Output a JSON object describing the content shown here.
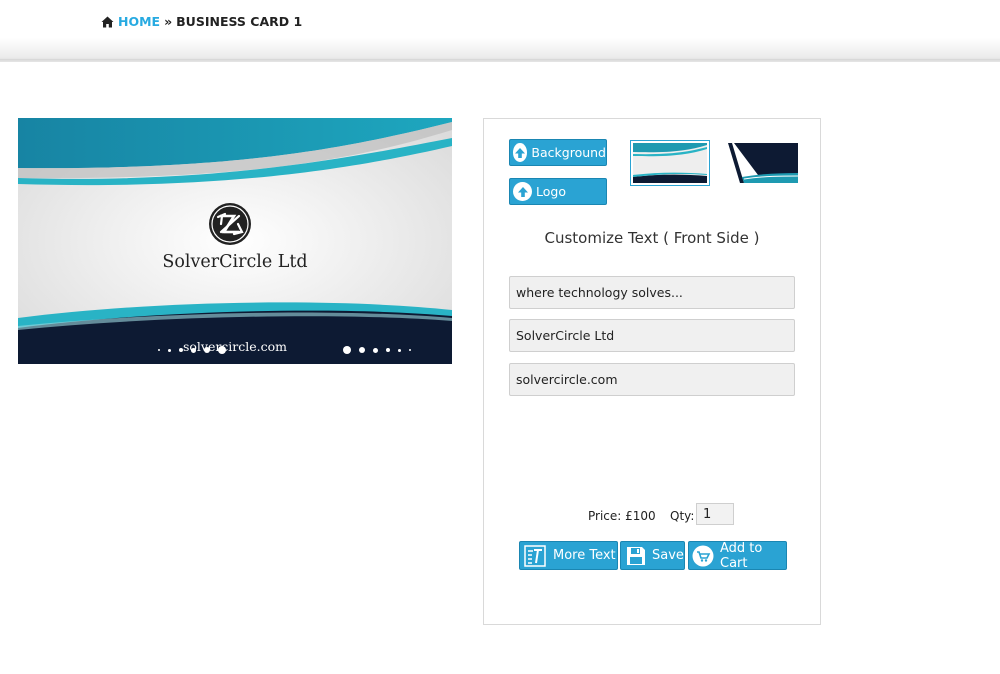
{
  "breadcrumb": {
    "home_icon": "home-icon",
    "home": "HOME",
    "separator": "»",
    "current": "BUSINESS CARD 1"
  },
  "card": {
    "company": "SolverCircle Ltd",
    "website": "solvercircle.com",
    "colors": {
      "teal": "#1e9ab1",
      "navy": "#0d1a33",
      "accent": "#27aae1"
    }
  },
  "editor": {
    "background_button": "Background",
    "logo_button": "Logo",
    "title": "Customize Text ( Front Side )",
    "fields": [
      "where technology solves...",
      "SolverCircle Ltd",
      "solvercircle.com"
    ],
    "price": "Price: £100",
    "qty_label": "Qty:",
    "qty_value": "1",
    "more_text_button": "More Text",
    "save_button": "Save",
    "add_to_cart_button": "Add to Cart",
    "accent_color": "#2aa3d3"
  }
}
